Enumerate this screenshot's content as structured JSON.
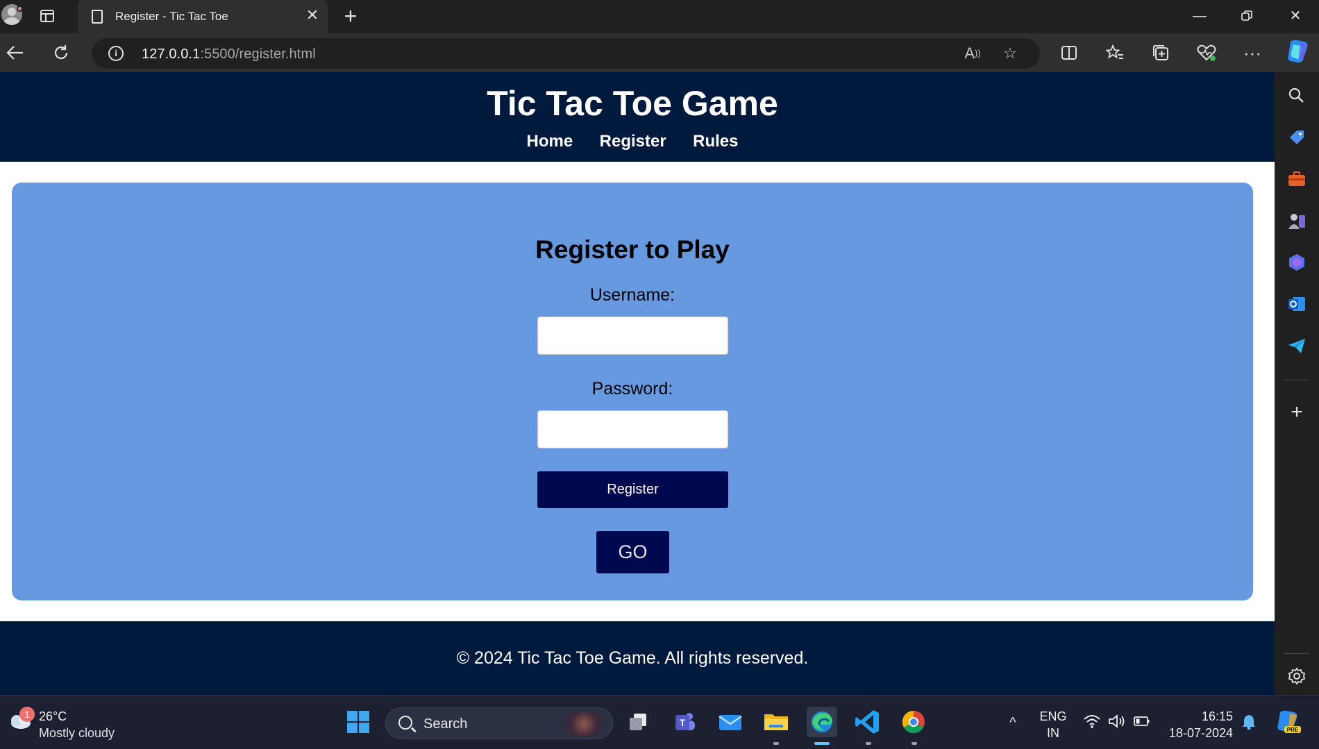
{
  "browser": {
    "tab_title": "Register - Tic Tac Toe",
    "url_host": "127.0.0.1",
    "url_rest": ":5500/register.html"
  },
  "page": {
    "header": {
      "title": "Tic Tac Toe Game",
      "nav": [
        "Home",
        "Register",
        "Rules"
      ]
    },
    "form": {
      "title": "Register to Play",
      "username_label": "Username:",
      "username_value": "",
      "password_label": "Password:",
      "password_value": "",
      "register_button": "Register",
      "go_button": "GO"
    },
    "footer": {
      "text": "© 2024 Tic Tac Toe Game. All rights reserved."
    },
    "colors": {
      "header_bg": "#001a3d",
      "card_bg": "#6699e0",
      "button_bg": "#000950"
    }
  },
  "taskbar": {
    "weather_temp": "26°C",
    "weather_text": "Mostly cloudy",
    "weather_badge": "1",
    "search_text": "Search",
    "lang_1": "ENG",
    "lang_2": "IN",
    "time": "16:15",
    "date": "18-07-2024"
  }
}
